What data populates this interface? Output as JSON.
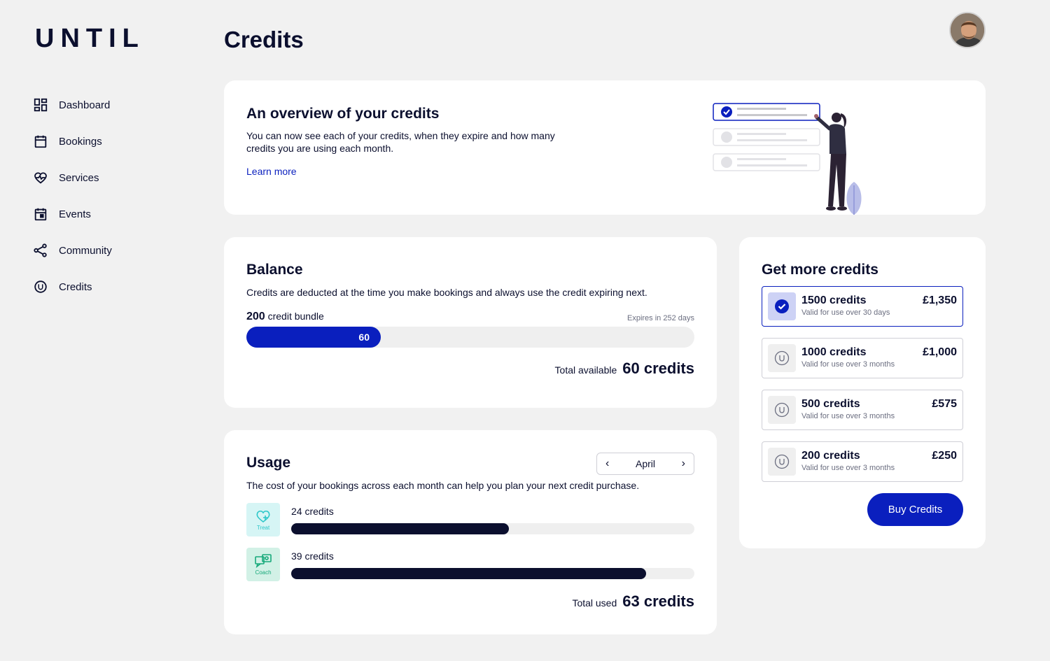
{
  "brand": {
    "logo_text": "UNTIL"
  },
  "nav": {
    "items": [
      {
        "label": "Dashboard",
        "icon": "dashboard-icon"
      },
      {
        "label": "Bookings",
        "icon": "calendar-icon"
      },
      {
        "label": "Services",
        "icon": "heart-pulse-icon"
      },
      {
        "label": "Events",
        "icon": "event-icon"
      },
      {
        "label": "Community",
        "icon": "share-icon"
      },
      {
        "label": "Credits",
        "icon": "credit-icon"
      }
    ]
  },
  "page": {
    "title": "Credits"
  },
  "overview": {
    "title": "An overview of your credits",
    "description": "You can now see each of your credits, when they expire and how many credits you are using each month.",
    "link": "Learn more"
  },
  "balance": {
    "title": "Balance",
    "description": "Credits are deducted at the time you make bookings and always use the credit expiring next.",
    "bundle_size": "200",
    "bundle_suffix": "credit bundle",
    "expires": "Expires in 252 days",
    "remaining": "60",
    "remaining_fraction": 0.3,
    "total_label": "Total available",
    "total_value": "60 credits"
  },
  "usage": {
    "title": "Usage",
    "description": "The cost of your bookings across each month can help you plan your next credit purchase.",
    "month": "April",
    "rows": [
      {
        "icon_label": "Treat",
        "label": "24 credits",
        "fraction": 0.54,
        "icon_bg": "#d6f5f5",
        "icon_color": "#2cc7c9"
      },
      {
        "icon_label": "Coach",
        "label": "39 credits",
        "fraction": 0.88,
        "icon_bg": "#d2f1e6",
        "icon_color": "#17a97a"
      }
    ],
    "total_label": "Total used",
    "total_value": "63 credits"
  },
  "get_more": {
    "title": "Get more credits",
    "packs": [
      {
        "name": "1500 credits",
        "validity": "Valid for use over 30 days",
        "price": "£1,350",
        "selected": true
      },
      {
        "name": "1000 credits",
        "validity": "Valid for use over 3 months",
        "price": "£1,000",
        "selected": false
      },
      {
        "name": "500 credits",
        "validity": "Valid for use over 3 months",
        "price": "£575",
        "selected": false
      },
      {
        "name": "200 credits",
        "validity": "Valid for use over 3 months",
        "price": "£250",
        "selected": false
      }
    ],
    "buy_label": "Buy Credits"
  },
  "colors": {
    "accent": "#0a1fbe",
    "navy": "#0b0f2e",
    "background": "#f1f1f1"
  }
}
